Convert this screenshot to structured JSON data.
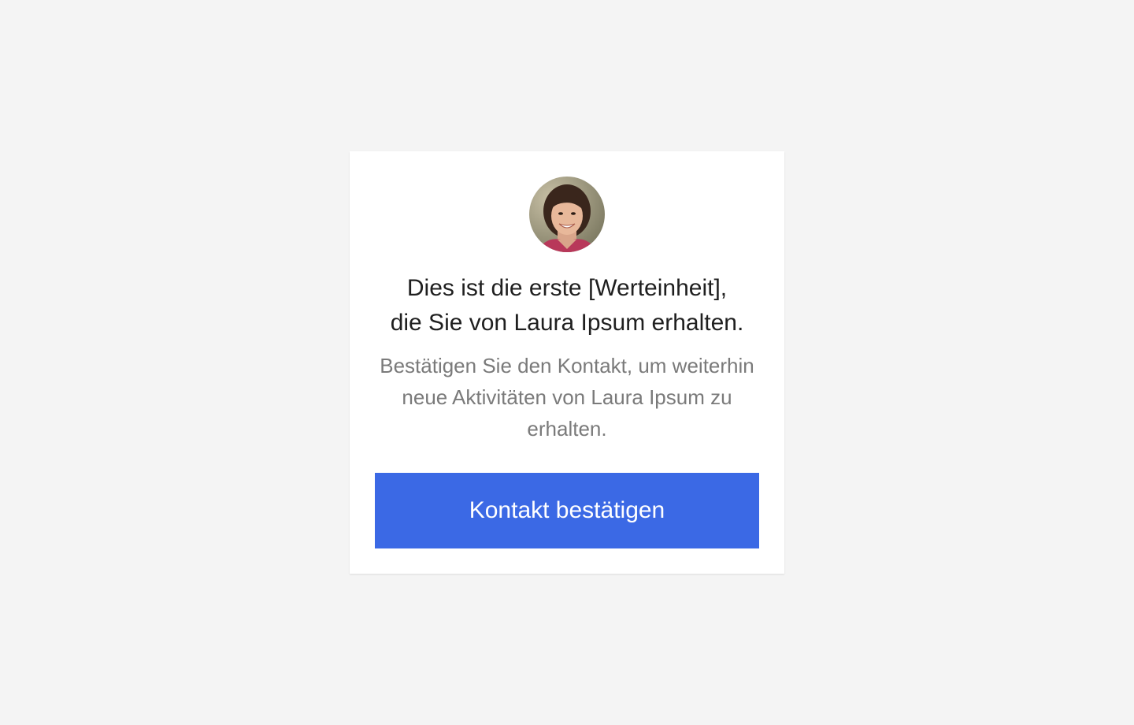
{
  "card": {
    "avatar_icon": "user-portrait-photo",
    "title_line1": "Dies ist die erste [Werteinheit],",
    "title_line2": "die Sie von Laura Ipsum erhalten.",
    "subtitle": "Bestätigen Sie den Kontakt, um weiterhin neue Aktivitäten von Laura Ipsum zu erhalten.",
    "confirm_label": "Kontakt bestätigen"
  },
  "colors": {
    "page_background": "#f4f4f4",
    "card_background": "#ffffff",
    "title_text": "#1f1f1f",
    "subtitle_text": "#7a7a7a",
    "button_background": "#3b69e5",
    "button_text": "#ffffff"
  }
}
